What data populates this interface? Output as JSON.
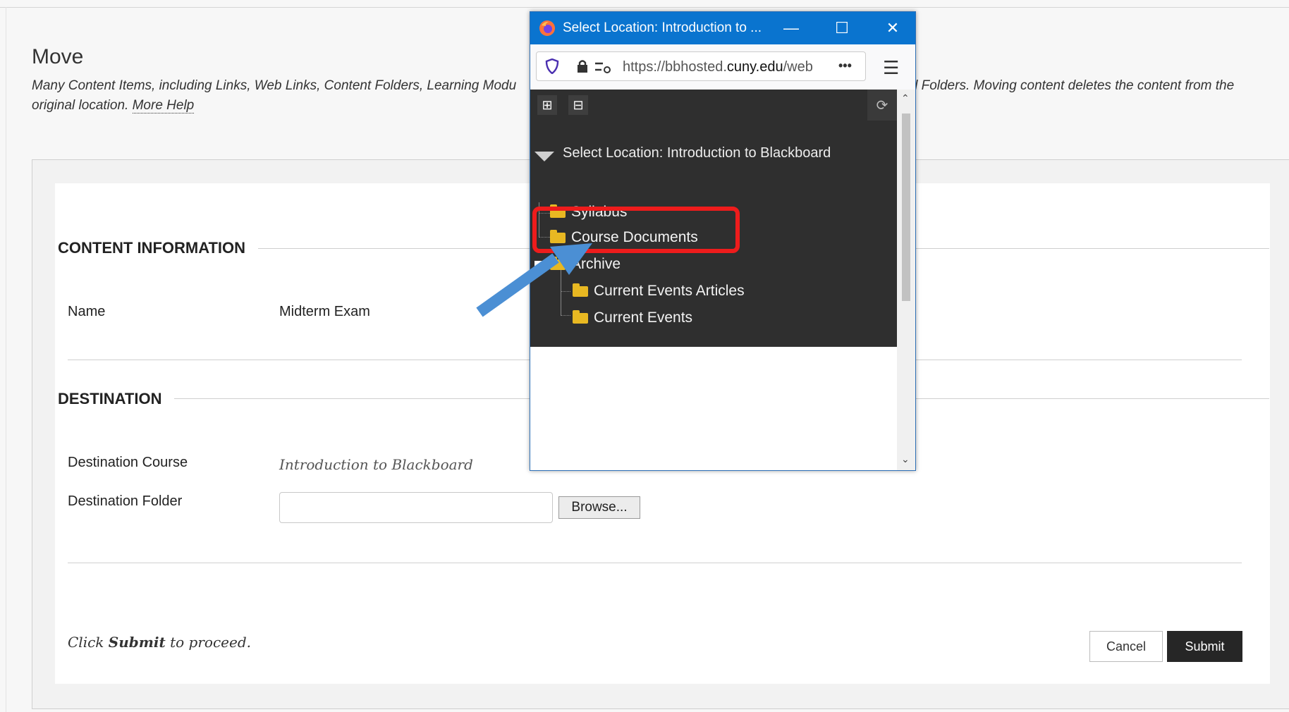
{
  "page": {
    "title": "Move",
    "description": "Many Content Items, including Links, Web Links, Content Folders, Learning Modu",
    "description_tail": "nd Folders. Moving content deletes the content from the",
    "description_line2": "original location.",
    "more_help": "More Help"
  },
  "content_info": {
    "heading": "CONTENT INFORMATION",
    "name_label": "Name",
    "name_value": "Midterm Exam"
  },
  "destination": {
    "heading": "DESTINATION",
    "course_label": "Destination Course",
    "course_value": "Introduction to Blackboard",
    "folder_label": "Destination Folder",
    "folder_value": "",
    "browse_label": "Browse..."
  },
  "footer": {
    "hint_prefix": "Click",
    "hint_bold": "Submit",
    "hint_suffix": "to proceed.",
    "cancel_label": "Cancel",
    "submit_label": "Submit"
  },
  "popup": {
    "window_title": "Select Location: Introduction to ...",
    "url_host": "https://bbhosted.",
    "url_domain": "cuny.edu",
    "url_path": "/web",
    "url_more": "•••",
    "tree_root": "Select Location: Introduction to Blackboard",
    "nodes": {
      "syllabus": "Syllabus",
      "course_documents": "Course Documents",
      "archive": "Archive",
      "current_events_articles": "Current Events Articles",
      "current_events": "Current Events"
    }
  },
  "colors": {
    "titlebar": "#0a74cf",
    "tree_bg": "#2f2f2f",
    "highlight": "#ee1c1c",
    "arrow": "#4b8fd4",
    "folder": "#e8b822"
  },
  "icons": [
    "firefox-icon",
    "minimize-icon",
    "maximize-icon",
    "close-icon",
    "shield-icon",
    "lock-icon",
    "permissions-icon",
    "hamburger-menu-icon",
    "expand-all-icon",
    "collapse-all-icon",
    "refresh-icon",
    "folder-icon",
    "collapse-node-icon"
  ]
}
